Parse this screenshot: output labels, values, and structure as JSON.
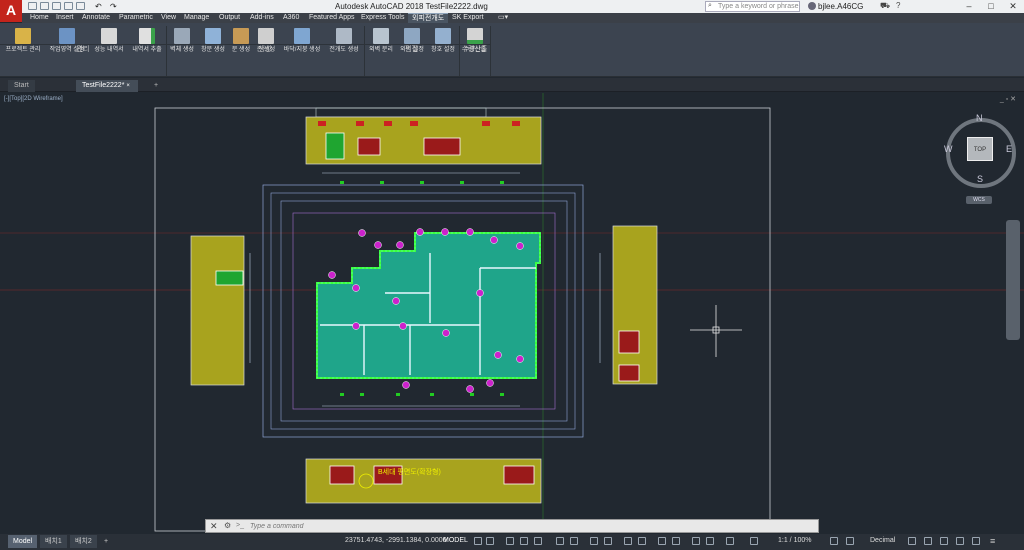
{
  "app": {
    "logo": "A",
    "title": "Autodesk AutoCAD 2018    TestFile2222.dwg"
  },
  "search": {
    "placeholder": "Type a keyword or phrase"
  },
  "user": {
    "name": "bjlee.A46CG"
  },
  "window_controls": [
    "–",
    "□",
    "✕"
  ],
  "ribbon": {
    "tabs": [
      "Home",
      "Insert",
      "Annotate",
      "Parametric",
      "View",
      "Manage",
      "Output",
      "Add-ins",
      "A360",
      "Featured Apps",
      "Express Tools",
      "외피전개도",
      "SK Export"
    ],
    "active_tab": "외피전개도",
    "buttons": [
      {
        "label": "프로젝트 관리",
        "icon": "folder-icon"
      },
      {
        "label": "작업영역 설정",
        "icon": "workspace-icon"
      },
      {
        "label": "성능 내역서",
        "icon": "report-icon"
      },
      {
        "label": "내역서 추출",
        "icon": "export-icon"
      },
      {
        "label": "벽체 생성",
        "icon": "wall-icon"
      },
      {
        "label": "창문 생성",
        "icon": "window-icon"
      },
      {
        "label": "문 생성",
        "icon": "door-icon"
      },
      {
        "label": "존 생성",
        "icon": "zone-icon"
      },
      {
        "label": "바닥/지붕 생성",
        "icon": "roof-icon"
      },
      {
        "label": "전개도 생성",
        "icon": "elevation-icon"
      },
      {
        "label": "외벽 분리",
        "icon": "split-icon"
      },
      {
        "label": "외벽 설정",
        "icon": "wall-setting-icon"
      },
      {
        "label": "창호 설정",
        "icon": "window-setting-icon"
      },
      {
        "label": "수량산출",
        "icon": "quantity-icon"
      }
    ],
    "groups": [
      "관리",
      "생성",
      "편집",
      "수량산출"
    ]
  },
  "doc_tabs": [
    "Start",
    "TestFile2222*",
    "+"
  ],
  "viewport": {
    "label": "[-][Top][2D Wireframe]",
    "window_controls": "_ ▫ ✕"
  },
  "viewcube": {
    "top": "TOP",
    "n": "N",
    "s": "S",
    "e": "E",
    "w": "W",
    "wcs": "WCS"
  },
  "drawing": {
    "title_text": "B세대 평면도(확장형)"
  },
  "commandline": {
    "placeholder": "Type a command",
    "close": "✕",
    "prompt": ">_"
  },
  "statusbar": {
    "layout_tabs": [
      "Model",
      "배치1",
      "배치2",
      "+"
    ],
    "coords": "23751.4743, -2991.1384, 0.0000",
    "mode": "MODEL",
    "scale": "1:1 / 100%",
    "units": "Decimal"
  }
}
